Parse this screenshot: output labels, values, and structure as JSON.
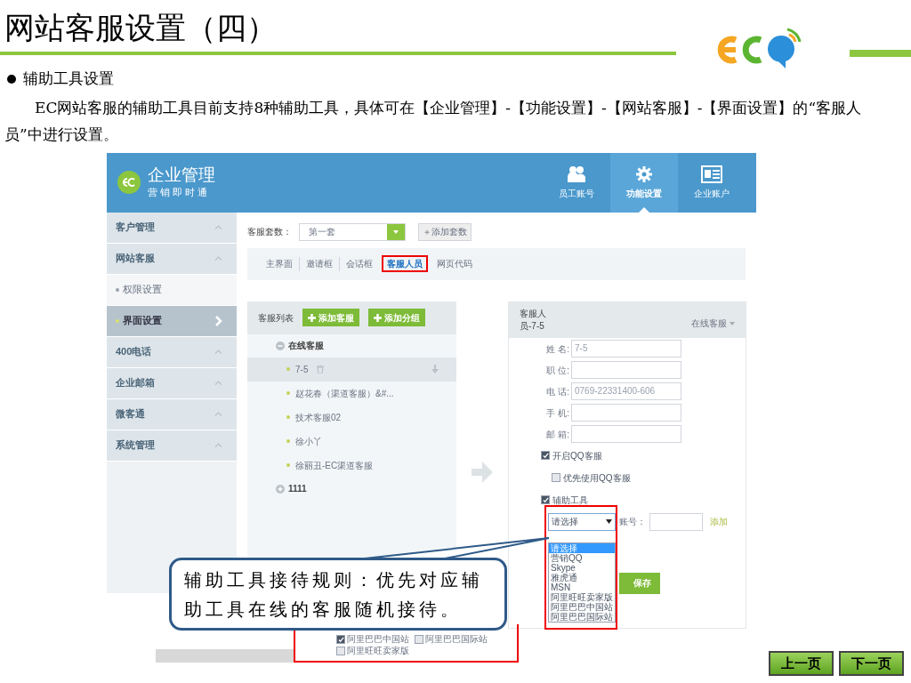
{
  "slide": {
    "title": "网站客服设置（四）",
    "bullet": "辅助工具设置",
    "paragraph": "EC网站客服的辅助工具目前支持8种辅助工具，具体可在【企业管理】-【功能设置】-【网站客服】-【界面设置】的“客服人员”中进行设置。"
  },
  "app": {
    "brand": "企业管理",
    "tagline": "营销即时通",
    "nav": [
      {
        "label": "员工账号",
        "kind": "people",
        "selected": false
      },
      {
        "label": "功能设置",
        "kind": "gear",
        "selected": true
      },
      {
        "label": "企业账户",
        "kind": "card",
        "selected": false
      }
    ],
    "sidebar": [
      {
        "label": "客户管理",
        "kind": "section",
        "selected": false
      },
      {
        "label": "网站客服",
        "kind": "section",
        "selected": false
      },
      {
        "label": "权限设置",
        "kind": "sub",
        "selected": false
      },
      {
        "label": "界面设置",
        "kind": "sub",
        "selected": true
      },
      {
        "label": "400电话",
        "kind": "section",
        "selected": false
      },
      {
        "label": "企业邮箱",
        "kind": "section",
        "selected": false
      },
      {
        "label": "微客通",
        "kind": "section",
        "selected": false
      },
      {
        "label": "系统管理",
        "kind": "section",
        "selected": false
      }
    ],
    "suite": {
      "label": "客服套数：",
      "value": "第一套",
      "add_button": "＋添加套数"
    },
    "tabs": [
      {
        "label": "主界面",
        "selected": false
      },
      {
        "label": "邀请框",
        "selected": false
      },
      {
        "label": "会话框",
        "selected": false
      },
      {
        "label": "客服人员",
        "selected": true
      },
      {
        "label": "网页代码",
        "selected": false
      }
    ],
    "staff_list": {
      "title": "客服列表",
      "buttons": [
        "添加客服",
        "添加分组"
      ],
      "groups": [
        {
          "name": "在线客服",
          "expanded": true,
          "children": [
            {
              "name": "7-5",
              "selected": true
            },
            {
              "name": "赵花春（渠道客服）&#...",
              "selected": false
            },
            {
              "name": "技术客服02",
              "selected": false
            },
            {
              "name": "徐小丫",
              "selected": false
            },
            {
              "name": "徐丽丑-EC渠道客服",
              "selected": false
            }
          ]
        },
        {
          "name": "1111",
          "expanded": false
        }
      ]
    },
    "detail": {
      "title": "客服人员-7-5",
      "group_select": "在线客服",
      "fields": [
        {
          "label": "姓 名:",
          "value": "7-5"
        },
        {
          "label": "职 位:"
        },
        {
          "label": "电 话:",
          "value": "0769-22331400-606"
        },
        {
          "label": "手 机:"
        },
        {
          "label": "邮 箱:"
        }
      ],
      "checks": [
        {
          "label": "开启QQ客服",
          "checked": true,
          "kind": "main"
        },
        {
          "label": "优先使用QQ客服",
          "checked": false,
          "kind": "sub"
        },
        {
          "label": "辅助工具",
          "checked": true,
          "kind": "main"
        }
      ],
      "tool_select": "请选择",
      "account_label": "账号：",
      "add_link": "添加",
      "options": [
        {
          "label": "请选择",
          "selected": true
        },
        {
          "label": "营销QQ",
          "selected": false
        },
        {
          "label": "Skype",
          "selected": false
        },
        {
          "label": "雅虎通",
          "selected": false
        },
        {
          "label": "MSN",
          "selected": false
        },
        {
          "label": "阿里旺旺卖家版",
          "selected": false
        },
        {
          "label": "阿里巴巴中国站",
          "selected": false
        },
        {
          "label": "阿里巴巴国际站",
          "selected": false
        }
      ],
      "save_button": "保存"
    },
    "bottom_checks": [
      {
        "label": "阿里巴巴中国站",
        "checked": true
      },
      {
        "label": "阿里巴巴国际站",
        "checked": false
      },
      {
        "label": "阿里旺旺卖家版",
        "checked": false
      }
    ]
  },
  "callout": "辅助工具接待规则：优先对应辅助工具在线的客服随机接待。",
  "pager": [
    "上一页",
    "下一页"
  ]
}
